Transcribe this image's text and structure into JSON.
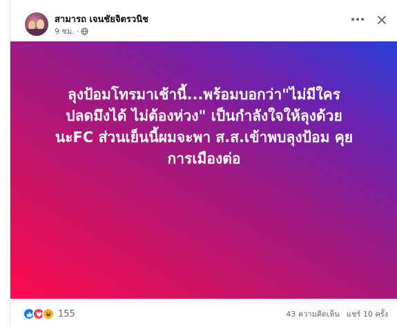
{
  "post": {
    "author": "สามารถ เจนชัยจิตรวนิช",
    "time": "9 ชม.",
    "text_lines": [
      "ลุงป้อมโทรมาเช้านี้...พร้อมบอกว่า\"ไม่มีใคร",
      "ปลดมึงได้ ไม่ต้องห่วง\" เป็นกำลังใจให้ลุงด้วย",
      "นะFC ส่วนเย็นนี้ผมจะพา ส.ส.เข้าพบลุงป้อม คุย",
      "การเมืองต่อ"
    ],
    "background_colors": [
      "#ff0a4f",
      "#9a1a86",
      "#2b3fd8"
    ]
  },
  "footer": {
    "reaction_count": "155",
    "comments": "43 ความคิดเห็น",
    "shares": "แชร์ 10 ครั้ง"
  },
  "icons": {
    "privacy": "globe-icon",
    "more": "more-options-icon",
    "close": "close-icon",
    "reactions": [
      "like-reaction-icon",
      "love-reaction-icon",
      "haha-reaction-icon"
    ]
  }
}
